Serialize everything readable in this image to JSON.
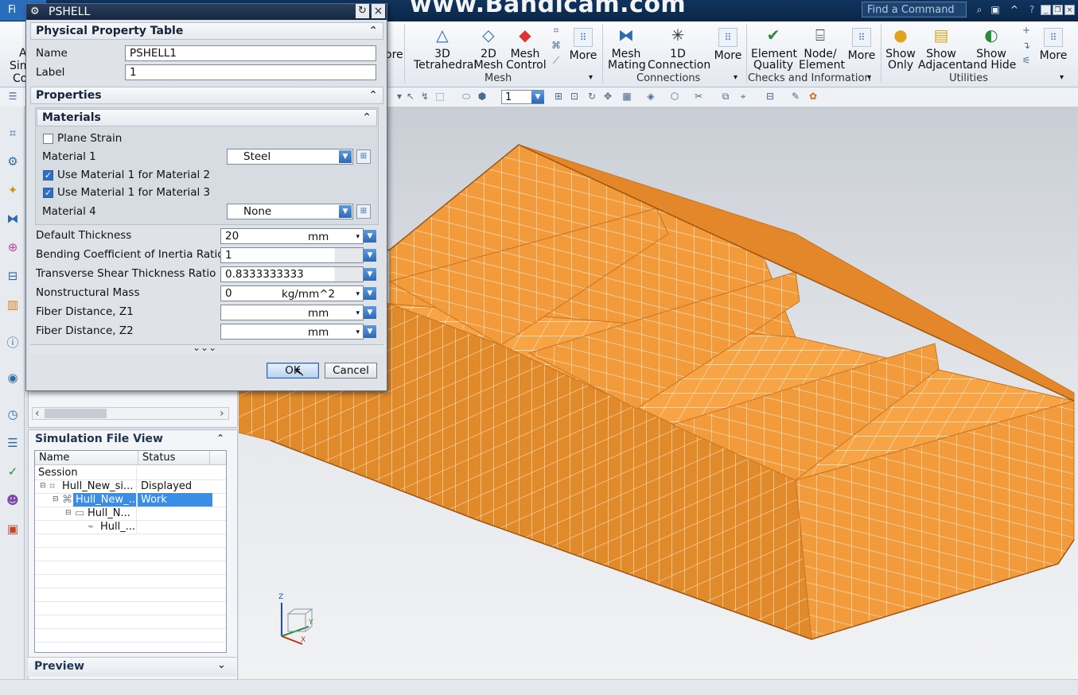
{
  "watermark": "www.Bandicam.com",
  "file_tab": "Fi",
  "command_search": {
    "placeholder": "Find a Command"
  },
  "ribbon": {
    "left_cut": {
      "l1": "A",
      "l2": "Sim",
      "l3": "Co"
    },
    "more_cut": "ore",
    "mesh_buttons": [
      {
        "l1": "3D",
        "l2": "Tetrahedral"
      },
      {
        "l1": "2D",
        "l2": "Mesh"
      },
      {
        "l1": "Mesh",
        "l2": "Control"
      },
      {
        "l1": "More",
        "l2": ""
      }
    ],
    "connection_buttons": [
      {
        "l1": "Mesh",
        "l2": "Mating"
      },
      {
        "l1": "1D",
        "l2": "Connection"
      },
      {
        "l1": "More",
        "l2": ""
      }
    ],
    "checks_buttons": [
      {
        "l1": "Element",
        "l2": "Quality"
      },
      {
        "l1": "Node/",
        "l2": "Element"
      },
      {
        "l1": "More",
        "l2": ""
      }
    ],
    "utility_buttons": [
      {
        "l1": "Show",
        "l2": "Only"
      },
      {
        "l1": "Show",
        "l2": "Adjacent"
      },
      {
        "l1": "Show",
        "l2": "and Hide"
      },
      {
        "l1": "More",
        "l2": ""
      }
    ],
    "groups": {
      "mesh": "Mesh",
      "connections": "Connections",
      "checks": "Checks and Information",
      "utilities": "Utilities"
    }
  },
  "toolbar2": {
    "selection_value": "1"
  },
  "dialog": {
    "title": "PSHELL",
    "property_table": {
      "header": "Physical Property Table",
      "name_label": "Name",
      "name_value": "PSHELL1",
      "label_label": "Label",
      "label_value": "1"
    },
    "properties": {
      "header": "Properties",
      "materials": {
        "header": "Materials",
        "plane_strain": "Plane Strain",
        "material1_label": "Material 1",
        "material1_value": "Steel",
        "use_m1_for_m2": "Use Material 1 for Material 2",
        "use_m1_for_m3": "Use Material 1 for Material 3",
        "material4_label": "Material 4",
        "material4_value": "None"
      },
      "fields": [
        {
          "label": "Default Thickness",
          "value": "20",
          "unit": "mm"
        },
        {
          "label": "Bending Coefficient of Inertia Ratio",
          "value": "1",
          "unit": ""
        },
        {
          "label": "Transverse Shear Thickness Ratio",
          "value": "0.8333333333",
          "unit": ""
        },
        {
          "label": "Nonstructural Mass",
          "value": "0",
          "unit": "kg/mm^2"
        },
        {
          "label": "Fiber Distance, Z1",
          "value": "",
          "unit": "mm"
        },
        {
          "label": "Fiber Distance, Z2",
          "value": "",
          "unit": "mm"
        }
      ]
    },
    "ok_label": "OK",
    "cancel_label": "Cancel"
  },
  "simulation_file_view": {
    "title": "Simulation File View",
    "columns": [
      "Name",
      "Status"
    ],
    "rows": [
      {
        "name": "Session",
        "status": ""
      },
      {
        "name": "Hull_New_si...",
        "status": "Displayed"
      },
      {
        "name": "Hull_New_...",
        "status": "Work"
      },
      {
        "name": "Hull_N...",
        "status": ""
      },
      {
        "name": "Hull_...",
        "status": ""
      }
    ]
  },
  "preview": {
    "title": "Preview"
  },
  "triad": {
    "z": "Z",
    "y": "Y",
    "x": "X"
  },
  "colors": {
    "mesh": "#f39a3b",
    "mesh_line": "#fff0d8",
    "selection": "#3a8ee6",
    "title_bar": "#10345e"
  }
}
